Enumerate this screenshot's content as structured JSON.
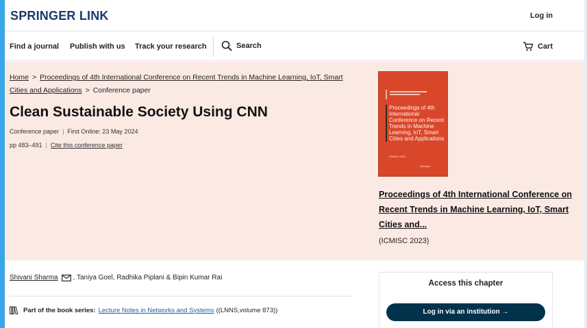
{
  "header": {
    "logo": "SPRINGER LINK",
    "login_label": "Log in"
  },
  "nav": {
    "items": [
      "Find a journal",
      "Publish with us",
      "Track your research"
    ],
    "search_label": "Search",
    "cart_label": "Cart"
  },
  "breadcrumb": {
    "home": "Home",
    "sep": ">",
    "proceedings": "Proceedings of 4th International Conference on Recent Trends in Machine Learning, IoT, Smart Cities and Applications",
    "current": "Conference paper"
  },
  "paper": {
    "title": "Clean Sustainable Society Using CNN",
    "type": "Conference paper",
    "first_online": "First Online: 23 May 2024",
    "pages": "pp 483–491",
    "cite_label": "Cite this conference paper"
  },
  "book": {
    "cover_title": "Proceedings of 4th International Conference on Recent Trends in Machine Learning, IoT, Smart Cities and Applications",
    "cover_sub": "ICMISC 2023",
    "cover_publisher": "Springer",
    "link_text": "Proceedings of 4th International Conference on Recent Trends in Machine Learning, IoT, Smart Cities and...",
    "subtitle": "(ICMISC 2023)"
  },
  "authors": {
    "first": "Shivani Sharma",
    "rest": ", Taniya Goel, Radhika Piplani & Bipin Kumar Rai"
  },
  "series": {
    "prefix": "Part of the book series:",
    "link": "Lecture Notes in Networks and Systems",
    "suffix": "((LNNS,volume 873))"
  },
  "access": {
    "title": "Access this chapter",
    "button": "Log in via an institution →"
  },
  "colors": {
    "brand": "#1b3a6b",
    "hero_bg": "#fbe9e4",
    "cover": "#d9472b",
    "button": "#01324b",
    "series_link": "#1f5fa5"
  }
}
